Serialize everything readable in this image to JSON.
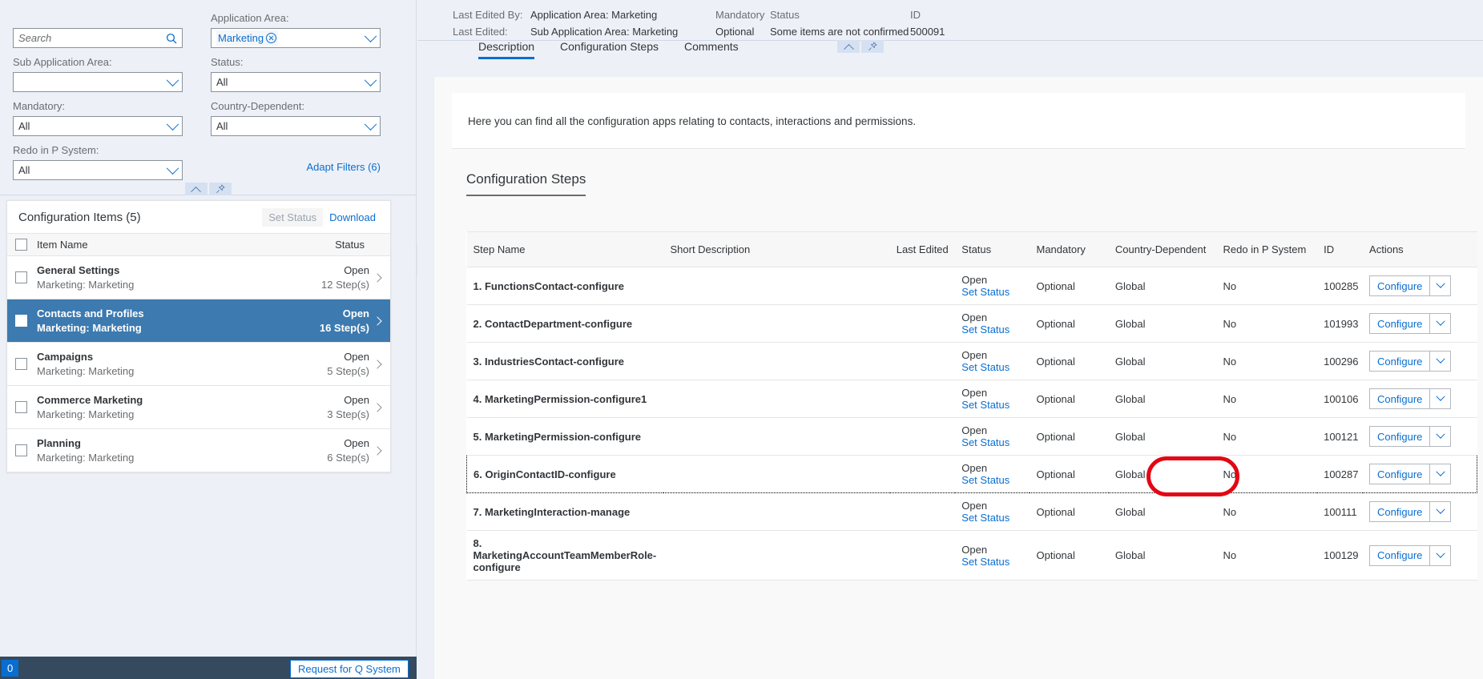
{
  "filters": {
    "search": {
      "placeholder": "Search",
      "value": "",
      "icon": "search-icon"
    },
    "application_area": {
      "label": "Application Area:",
      "value": "Marketing",
      "icon": "chevron-down-icon"
    },
    "sub_application_area": {
      "label": "Sub Application Area:",
      "value": "",
      "icon": "chevron-down-icon"
    },
    "status": {
      "label": "Status:",
      "value": "All",
      "icon": "chevron-down-icon"
    },
    "mandatory": {
      "label": "Mandatory:",
      "value": "All",
      "icon": "chevron-down-icon"
    },
    "country_dependent": {
      "label": "Country-Dependent:",
      "value": "All",
      "icon": "chevron-down-icon"
    },
    "redo_in_p_system": {
      "label": "Redo in P System:",
      "value": "All",
      "icon": "chevron-down-icon"
    },
    "adapt_filters": "Adapt Filters (6)"
  },
  "config_items": {
    "title": "Configuration Items (5)",
    "set_status_label": "Set Status",
    "download_label": "Download",
    "columns": {
      "name": "Item Name",
      "status": "Status"
    },
    "rows": [
      {
        "name": "General Settings",
        "sub": "Marketing: Marketing",
        "status": "Open",
        "steps": "12 Step(s)",
        "selected": false
      },
      {
        "name": "Contacts and Profiles",
        "sub": "Marketing: Marketing",
        "status": "Open",
        "steps": "16 Step(s)",
        "selected": true
      },
      {
        "name": "Campaigns",
        "sub": "Marketing: Marketing",
        "status": "Open",
        "steps": "5 Step(s)",
        "selected": false
      },
      {
        "name": "Commerce Marketing",
        "sub": "Marketing: Marketing",
        "status": "Open",
        "steps": "3 Step(s)",
        "selected": false
      },
      {
        "name": "Planning",
        "sub": "Marketing: Marketing",
        "status": "Open",
        "steps": "6 Step(s)",
        "selected": false
      }
    ]
  },
  "status_bar": {
    "badge": "0",
    "request_button": "Request for Q System"
  },
  "object_header": {
    "last_edited_by_label": "Last Edited By:",
    "last_edited_by_value": "",
    "last_edited_label": "Last Edited:",
    "last_edited_value": "",
    "application_area": "Application Area: Marketing",
    "sub_application_area": "Sub Application Area: Marketing",
    "mandatory_label": "Mandatory",
    "mandatory_value": "Optional",
    "status_label": "Status",
    "status_value": "Some items are not confirmed",
    "id_label": "ID",
    "id_value": "500091"
  },
  "tabs": [
    {
      "label": "Description",
      "active": true
    },
    {
      "label": "Configuration Steps",
      "active": false
    },
    {
      "label": "Comments",
      "active": false
    }
  ],
  "description": {
    "text": "Here you can find all the configuration apps relating to contacts, interactions and permissions."
  },
  "steps_section": {
    "title": "Configuration Steps",
    "columns": [
      "Step Name",
      "Short Description",
      "Last Edited",
      "Status",
      "Mandatory",
      "Country-Dependent",
      "Redo in P System",
      "ID",
      "Actions"
    ],
    "set_status_label": "Set Status",
    "configure_label": "Configure",
    "rows": [
      {
        "step": "1. FunctionsContact-configure",
        "desc": "",
        "last_edited": "",
        "status": "Open",
        "mandatory": "Optional",
        "country": "Global",
        "redo": "No",
        "id": "100285",
        "focused": false
      },
      {
        "step": "2. ContactDepartment-configure",
        "desc": "",
        "last_edited": "",
        "status": "Open",
        "mandatory": "Optional",
        "country": "Global",
        "redo": "No",
        "id": "101993",
        "focused": false
      },
      {
        "step": "3. IndustriesContact-configure",
        "desc": "",
        "last_edited": "",
        "status": "Open",
        "mandatory": "Optional",
        "country": "Global",
        "redo": "No",
        "id": "100296",
        "focused": false
      },
      {
        "step": "4. MarketingPermission-configure1",
        "desc": "",
        "last_edited": "",
        "status": "Open",
        "mandatory": "Optional",
        "country": "Global",
        "redo": "No",
        "id": "100106",
        "focused": false
      },
      {
        "step": "5. MarketingPermission-configure",
        "desc": "",
        "last_edited": "",
        "status": "Open",
        "mandatory": "Optional",
        "country": "Global",
        "redo": "No",
        "id": "100121",
        "focused": false
      },
      {
        "step": "6. OriginContactID-configure",
        "desc": "",
        "last_edited": "",
        "status": "Open",
        "mandatory": "Optional",
        "country": "Global",
        "redo": "No",
        "id": "100287",
        "focused": true
      },
      {
        "step": "7. MarketingInteraction-manage",
        "desc": "",
        "last_edited": "",
        "status": "Open",
        "mandatory": "Optional",
        "country": "Global",
        "redo": "No",
        "id": "100111",
        "focused": false
      },
      {
        "step": "8. MarketingAccountTeamMemberRole-configure",
        "desc": "",
        "last_edited": "",
        "status": "Open",
        "mandatory": "Optional",
        "country": "Global",
        "redo": "No",
        "id": "100129",
        "focused": false
      }
    ]
  },
  "colors": {
    "accent": "#0a6ed1",
    "selected_row": "#3c7ab0",
    "filter_bg": "#edf1f7",
    "annotation": "#e30613",
    "footer": "#354a5f"
  }
}
